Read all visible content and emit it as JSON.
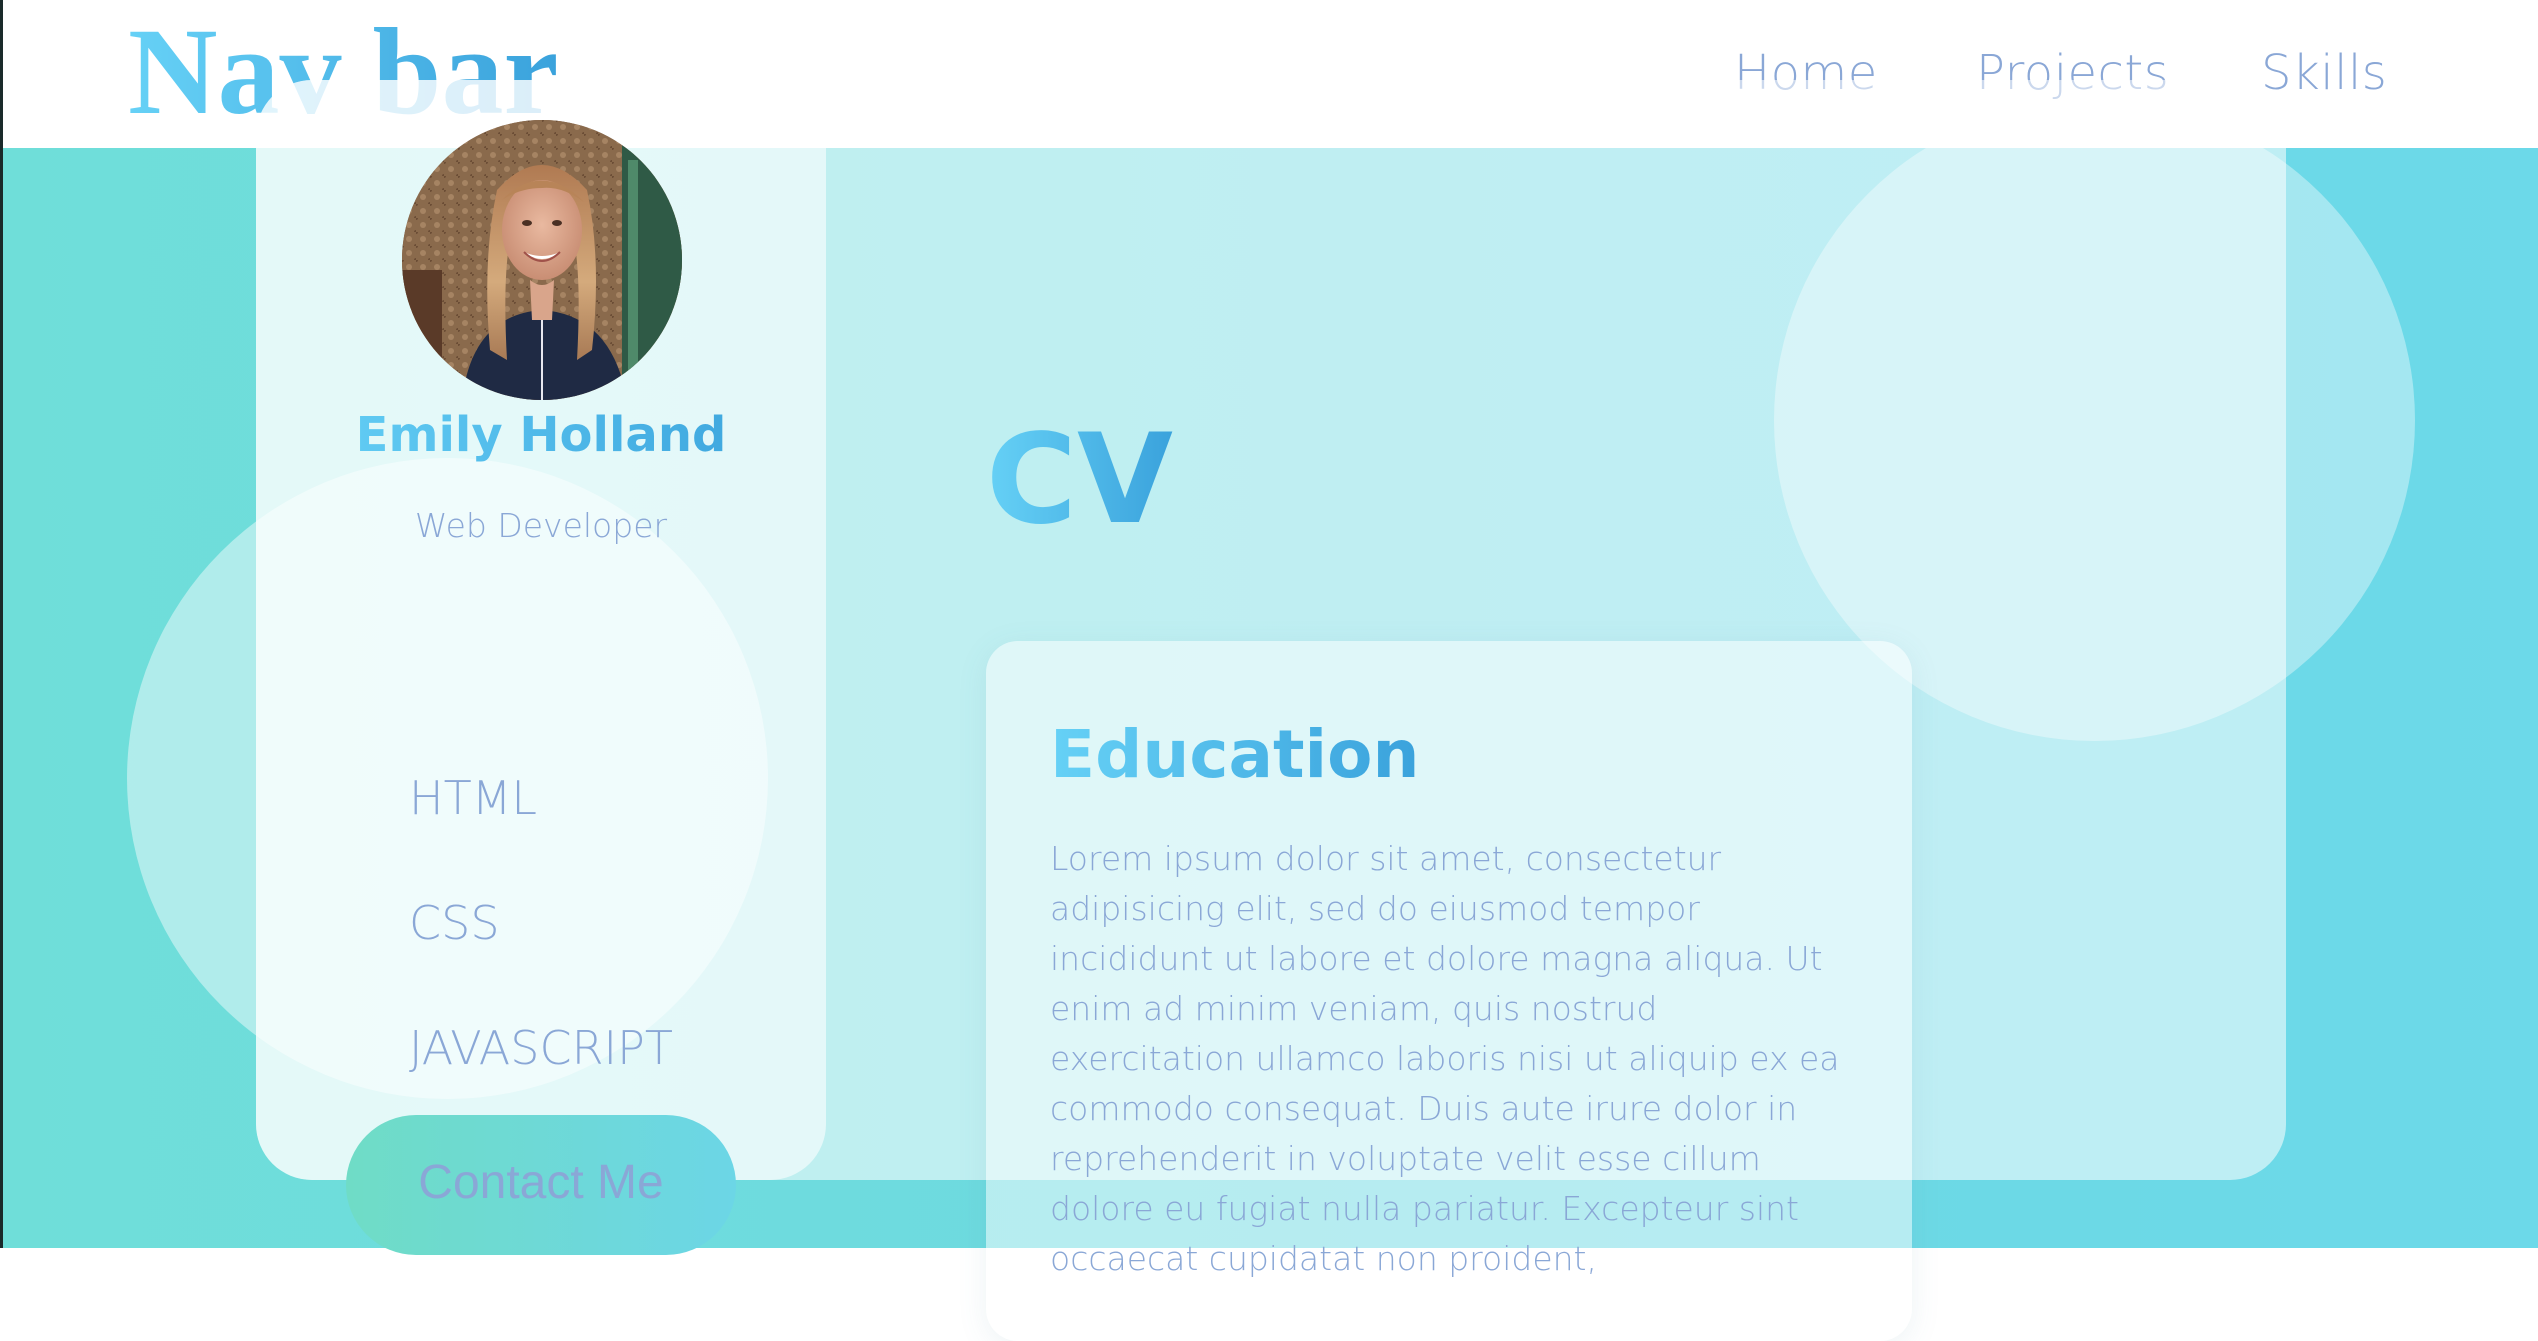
{
  "nav": {
    "brand": "Nav bar",
    "links": [
      "Home",
      "Projects",
      "Skills"
    ]
  },
  "profile": {
    "name": "Emily Holland",
    "role": "Web Developer",
    "skills": [
      "HTML",
      "CSS",
      "JAVASCRIPT"
    ],
    "contact_label": "Contact Me"
  },
  "main": {
    "title": "CV",
    "education": {
      "heading": "Education",
      "body": "Lorem ipsum dolor sit amet, consectetur adipisicing elit, sed do eiusmod tempor incididunt ut labore et dolore magna aliqua. Ut enim ad minim veniam, quis nostrud exercitation ullamco laboris nisi ut aliquip ex ea commodo consequat. Duis aute irure dolor in reprehenderit in voluptate velit esse cillum dolore eu fugiat nulla pariatur. Excepteur sint occaecat cupidatat non proident,"
    }
  },
  "colors": {
    "accent_gradient_start": "#66d1f6",
    "accent_gradient_end": "#3aa2dc",
    "text_muted": "#8aa7d6",
    "background_teal": "#6fded9",
    "button_gradient_start": "#6fdcc6"
  }
}
